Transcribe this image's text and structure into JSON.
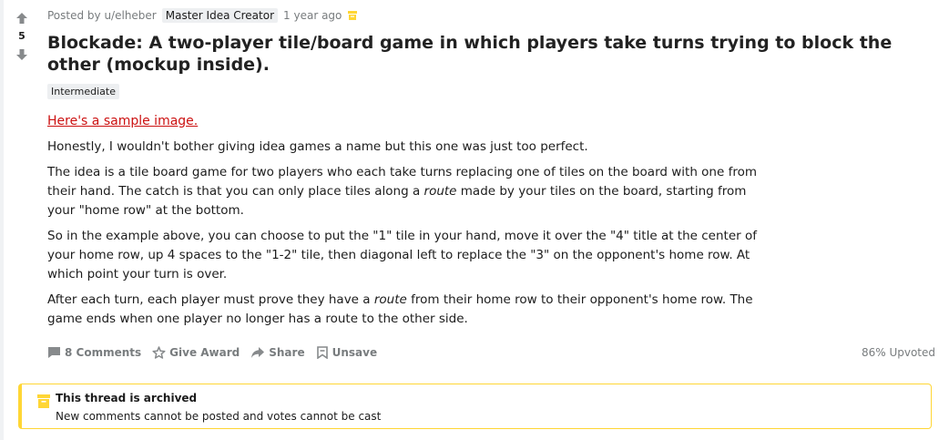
{
  "post": {
    "score": "5",
    "posted_by": "Posted by u/elheber",
    "user_flair": "Master Idea Creator",
    "time": "1 year ago",
    "title": "Blockade: A two-player tile/board game in which players take turns trying to block the other (mockup inside).",
    "flair": "Intermediate",
    "link_text": "Here's a sample image.",
    "p1": "Honestly, I wouldn't bother giving idea games a name but this one was just too perfect.",
    "p2_a": "The idea is a tile board game for two players who each take turns replacing one of tiles on the board with one from their hand. The catch is that you can only place tiles along a ",
    "p2_em": "route",
    "p2_b": " made by your tiles on the board, starting from your \"home row\" at the bottom.",
    "p3": "So in the example above, you can choose to put the \"1\" tile in your hand, move it over the \"4\" title at the center of your home row, up 4 spaces to the \"1-2\" tile, then diagonal left to replace the \"3\" on the opponent's home row. At which point your turn is over.",
    "p4_a": "After each turn, each player must prove they have a ",
    "p4_em": "route",
    "p4_b": " from their home row to their opponent's home row. The game ends when one player no longer has a route to the other side."
  },
  "actions": {
    "comments": "8 Comments",
    "award": "Give Award",
    "share": "Share",
    "unsave": "Unsave",
    "upvoted": "86% Upvoted"
  },
  "archived": {
    "title": "This thread is archived",
    "text": "New comments cannot be posted and votes cannot be cast"
  },
  "colors": {
    "archive_accent": "#ffd635",
    "link": "#cc1111",
    "muted": "#787c7e"
  }
}
